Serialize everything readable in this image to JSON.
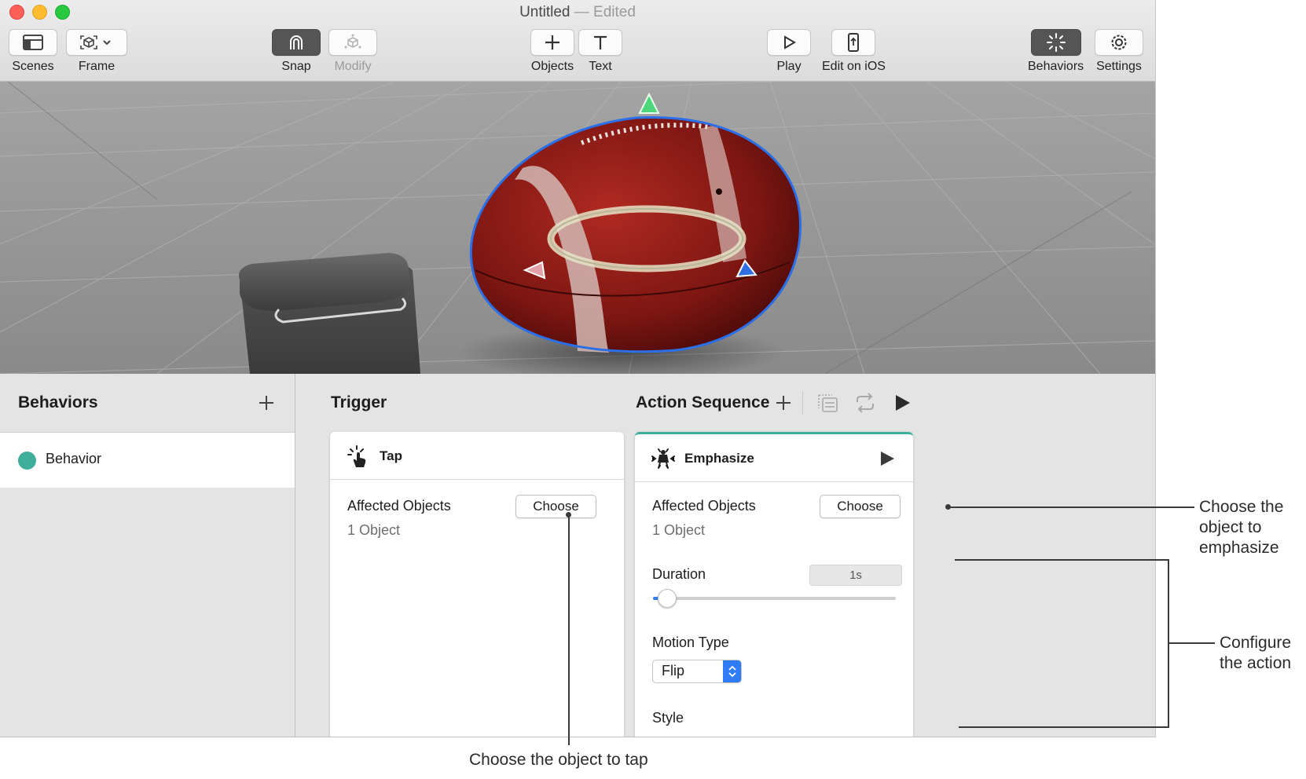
{
  "window": {
    "title": "Untitled",
    "separator": "—",
    "edited": "Edited"
  },
  "toolbar": {
    "scenes": "Scenes",
    "frame": "Frame",
    "snap": "Snap",
    "modify": "Modify",
    "objects": "Objects",
    "text": "Text",
    "play": "Play",
    "edit_on_ios": "Edit on iOS",
    "behaviors": "Behaviors",
    "settings": "Settings"
  },
  "behaviors_panel": {
    "title": "Behaviors",
    "items": [
      {
        "label": "Behavior",
        "color": "#3fae9a"
      }
    ]
  },
  "trigger": {
    "title": "Trigger",
    "card": {
      "name": "Tap",
      "icon": "tap-hand-icon",
      "affected_label": "Affected Objects",
      "choose_label": "Choose",
      "count": "1 Object"
    }
  },
  "action_sequence": {
    "title": "Action Sequence",
    "card": {
      "name": "Emphasize",
      "icon": "emphasize-icon",
      "affected_label": "Affected Objects",
      "choose_label": "Choose",
      "count": "1 Object",
      "duration_label": "Duration",
      "duration_value": "1s",
      "duration_slider_fraction": 0.03,
      "motion_type_label": "Motion Type",
      "motion_type_value": "Flip",
      "style_label": "Style"
    }
  },
  "callouts": {
    "choose_tap": "Choose the object to tap",
    "choose_emphasize": [
      "Choose the",
      "object to",
      "emphasize"
    ],
    "configure_action": [
      "Configure",
      "the action"
    ]
  },
  "colors": {
    "accent": "#2f7cf6",
    "behavior_dot": "#3fae9a",
    "selection_outline": "#2b6fe8"
  }
}
